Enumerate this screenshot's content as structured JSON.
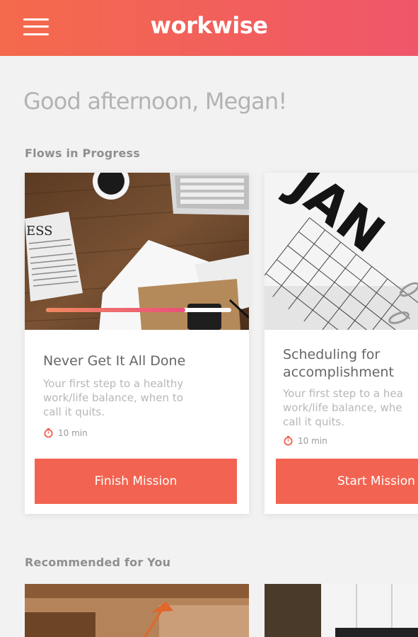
{
  "header": {
    "brand": "workwise",
    "menu_icon": "hamburger-menu-icon",
    "gradient": [
      "#f46a4c",
      "#f0566a"
    ]
  },
  "greeting": "Good afternoon, Megan!",
  "sections": {
    "flows_label": "Flows in Progress",
    "recommended_label": "Recommended for You"
  },
  "flows": [
    {
      "title": "Never Get It All Done",
      "description_lines": [
        "Your first step to a healthy",
        "work/life balance, when to",
        "call it quits."
      ],
      "duration": "10 min",
      "button": "Finish Mission",
      "progress": 0.75
    },
    {
      "title_lines": [
        "Scheduling for",
        "accomplishment"
      ],
      "description_lines": [
        "Your first step to a hea",
        "work/life balance, whe",
        "call it quits."
      ],
      "duration": "10 min",
      "button": "Start Mission",
      "image_text": "JAN"
    }
  ],
  "colors": {
    "accent": "#f26451",
    "background": "#f2f2f2"
  }
}
